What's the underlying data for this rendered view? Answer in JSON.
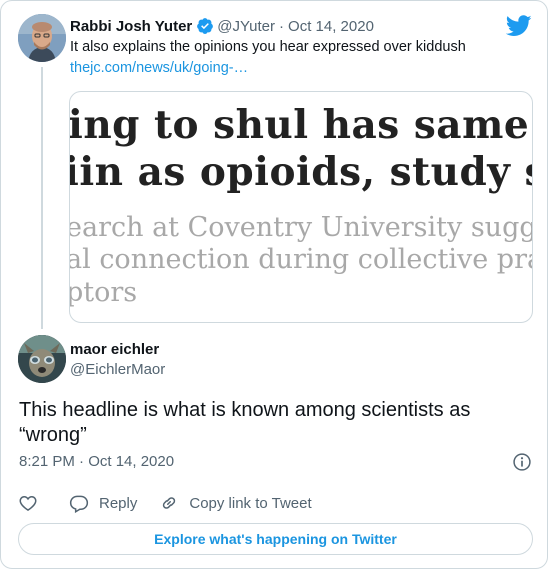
{
  "colors": {
    "accent": "#1b95e0",
    "secondary_text": "#536471",
    "border": "#cfd9de"
  },
  "parent_tweet": {
    "author_name": "Rabbi Josh Yuter",
    "handle": "@JYuter",
    "separator": "·",
    "date": "Oct 14, 2020",
    "text": "It also explains the opinions you hear expressed over kiddush",
    "link": "thejc.com/news/uk/going-…",
    "preview": {
      "headline_line1": "ing to shul has same effe",
      "headline_line2": "iin as opioids, study sug",
      "sub_line1": "earch at Coventry University suggests f",
      "sub_line2": "al connection during collective prayer s",
      "sub_line3": "ptors"
    }
  },
  "tweet": {
    "author_name": "maor eichler",
    "handle": "@EichlerMaor",
    "text": "This headline is what is known among scientists as “wrong”",
    "timestamp": "8:21 PM · Oct 14, 2020"
  },
  "actions": {
    "reply_label": "Reply",
    "copy_link_label": "Copy link to Tweet"
  },
  "explore_label": "Explore what's happening on Twitter",
  "icons": {
    "verified": "verified-badge-icon",
    "brand": "twitter-bird-icon",
    "info": "info-icon",
    "like": "heart-icon",
    "reply": "reply-bubble-icon",
    "copy": "link-icon"
  }
}
